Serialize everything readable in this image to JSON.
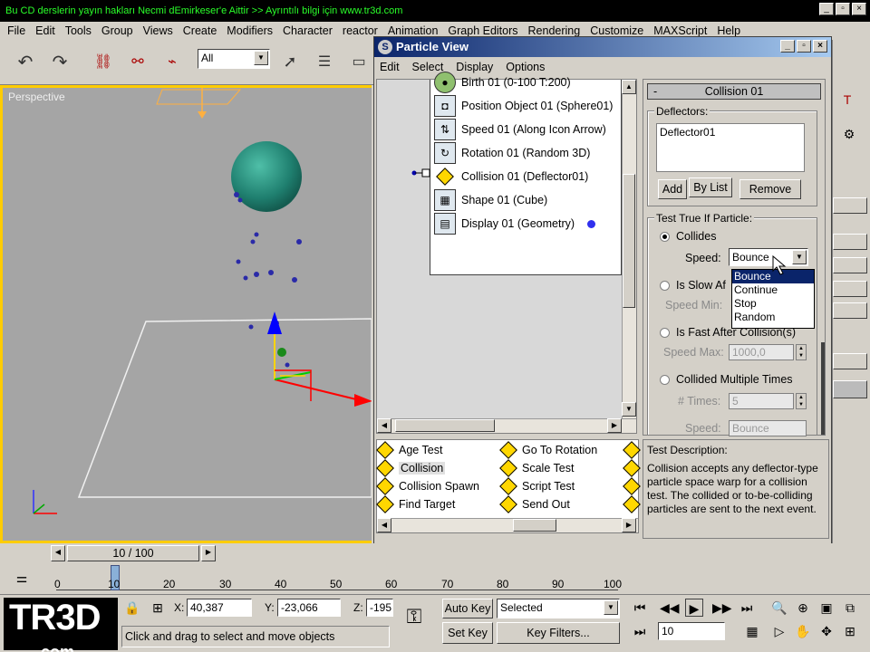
{
  "ticker": "Bu CD derslerin yayın hakları Necmi dEmirkeser'e Aittir >> Ayrıntılı bilgi için  www.tr3d.com",
  "main_window_buttons": [
    "_",
    "▫",
    "×"
  ],
  "menubar": [
    "File",
    "Edit",
    "Tools",
    "Group",
    "Views",
    "Create",
    "Modifiers",
    "Character",
    "reactor",
    "Animation",
    "Graph Editors",
    "Rendering",
    "Customize",
    "MAXScript",
    "Help"
  ],
  "toolbar": {
    "selection_filter": "All"
  },
  "viewport": {
    "label": "Perspective"
  },
  "particle_view": {
    "title": "Particle View",
    "menu": [
      "Edit",
      "Select",
      "Display",
      "Options"
    ],
    "nodes": [
      {
        "label": "Birth 01 (0-100 T:200)"
      },
      {
        "label": "Position Object 01 (Sphere01)"
      },
      {
        "label": "Speed 01 (Along Icon Arrow)"
      },
      {
        "label": "Rotation 01 (Random 3D)"
      },
      {
        "label": "Collision 01 (Deflector01)"
      },
      {
        "label": "Shape 01 (Cube)"
      },
      {
        "label": "Display 01 (Geometry)"
      }
    ],
    "rollout": {
      "title": "Collision 01",
      "deflectors_label": "Deflectors:",
      "deflector_item": "Deflector01",
      "add_label": "Add",
      "by_list_label": "By List",
      "remove_label": "Remove",
      "test_group_label": "Test True If Particle:",
      "collides_label": "Collides",
      "speed_label": "Speed:",
      "speed_value": "Bounce",
      "speed_options": [
        "Bounce",
        "Continue",
        "Stop",
        "Random"
      ],
      "is_slow_label": "Is Slow Af",
      "speed_min_label": "Speed Min:",
      "is_fast_label": "Is Fast After Collision(s)",
      "speed_max_label": "Speed Max:",
      "speed_max_value": "1000,0",
      "multiple_label": "Collided Multiple Times",
      "times_label": "# Times:",
      "times_value": "5",
      "speed2_label": "Speed:",
      "speed2_value": "Bounce"
    },
    "depot": [
      {
        "label": "Age Test"
      },
      {
        "label": "Go To Rotation"
      },
      {
        "label": "Collision"
      },
      {
        "label": "Scale Test"
      },
      {
        "label": "Collision Spawn"
      },
      {
        "label": "Script Test"
      },
      {
        "label": "Find Target"
      },
      {
        "label": "Send Out"
      }
    ],
    "description_title": "Test Description:",
    "description_text": "Collision accepts any deflector-type particle space warp for a collision test. The collided or to-be-colliding particles are sent to the next event."
  },
  "time_slider": {
    "label": "10 / 100",
    "ticks": [
      "0",
      "10",
      "20",
      "30",
      "40",
      "50",
      "60",
      "70",
      "80",
      "90",
      "100"
    ]
  },
  "status": {
    "x_label": "X:",
    "x_value": "40,387",
    "y_label": "Y:",
    "y_value": "-23,066",
    "z_label": "Z:",
    "z_value": "-195",
    "prompt": "Click and drag to select and move objects",
    "auto_key": "Auto Key",
    "set_key": "Set Key",
    "selected": "Selected",
    "key_filters": "Key Filters...",
    "frame": "10"
  },
  "logo": {
    "main": "TR3D",
    "sub": ".com"
  }
}
